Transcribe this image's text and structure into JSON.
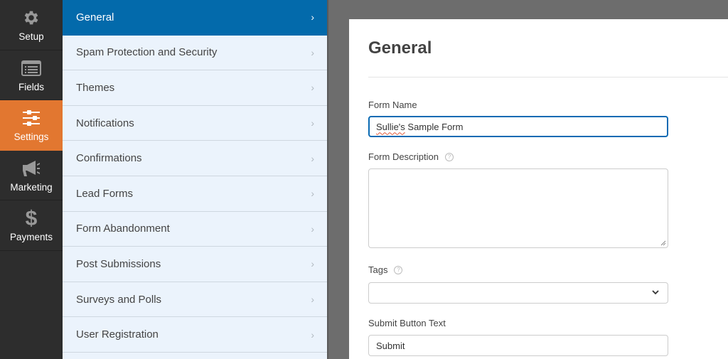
{
  "rail": {
    "items": [
      {
        "label": "Setup",
        "icon": "gear-icon",
        "active": false
      },
      {
        "label": "Fields",
        "icon": "fields-list-icon",
        "active": false
      },
      {
        "label": "Settings",
        "icon": "sliders-icon",
        "active": true
      },
      {
        "label": "Marketing",
        "icon": "megaphone-icon",
        "active": false
      },
      {
        "label": "Payments",
        "icon": "dollar-icon",
        "active": false
      }
    ]
  },
  "panel": {
    "items": [
      {
        "label": "General",
        "active": true
      },
      {
        "label": "Spam Protection and Security"
      },
      {
        "label": "Themes"
      },
      {
        "label": "Notifications"
      },
      {
        "label": "Confirmations"
      },
      {
        "label": "Lead Forms"
      },
      {
        "label": "Form Abandonment"
      },
      {
        "label": "Post Submissions"
      },
      {
        "label": "Surveys and Polls"
      },
      {
        "label": "User Registration"
      }
    ],
    "chevron": "›"
  },
  "main": {
    "title": "General",
    "form_name": {
      "label": "Form Name",
      "value_misspelled": "Sullie's",
      "value_rest": " Sample Form"
    },
    "form_description": {
      "label": "Form Description",
      "value": "",
      "help": "?"
    },
    "tags": {
      "label": "Tags",
      "value": "",
      "help": "?"
    },
    "submit_text": {
      "label": "Submit Button Text",
      "value": "Submit"
    }
  },
  "colors": {
    "rail_bg": "#2d2d2d",
    "rail_active": "#e27730",
    "panel_bg": "#ebf3fc",
    "panel_active": "#036aab",
    "focus_border": "#0a6ab3"
  }
}
